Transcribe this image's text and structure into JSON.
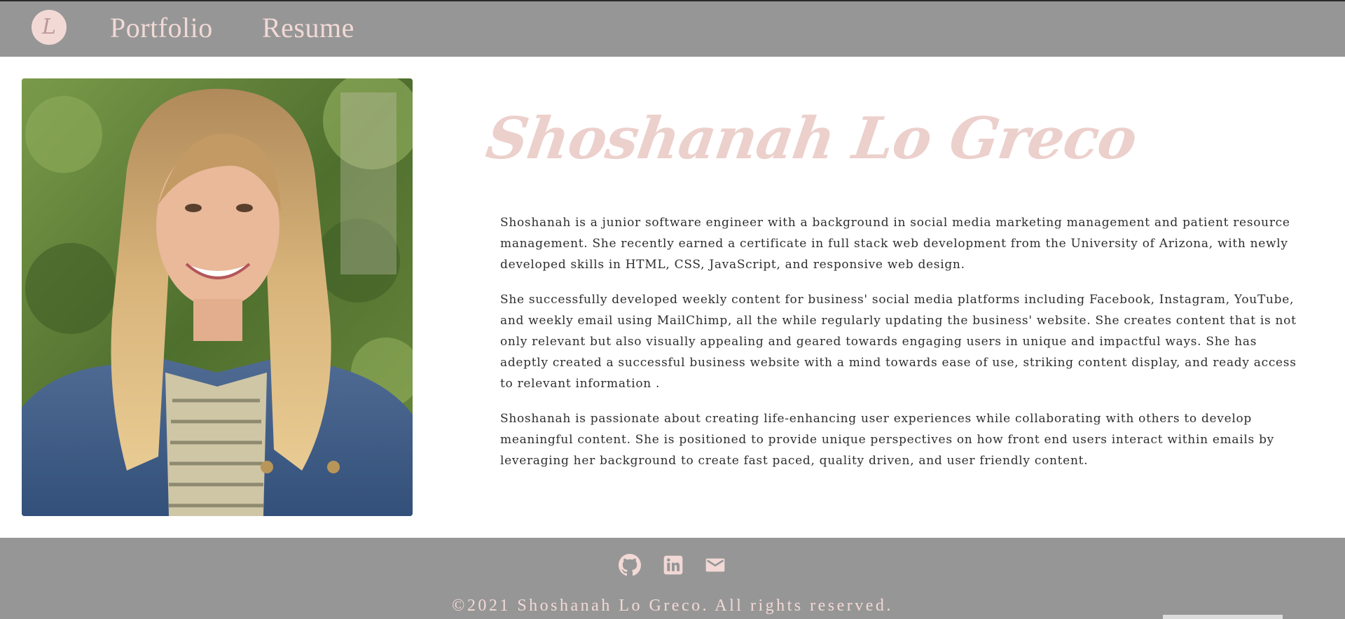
{
  "nav": {
    "logo_letter": "L",
    "links": [
      "Portfolio",
      "Resume"
    ]
  },
  "profile": {
    "photo_alt": "Portrait photo",
    "name": "Shoshanah Lo Greco"
  },
  "bio": {
    "paragraphs": [
      "Shoshanah is a junior software engineer with a background in social media marketing management and patient resource management. She recently earned a certificate in full stack web development from the University of Arizona, with newly developed skills in HTML, CSS, JavaScript, and responsive web design.",
      "She successfully developed weekly content for business' social media platforms including Facebook, Instagram, YouTube, and weekly email using MailChimp, all the while regularly updating the business' website. She creates content that is not only relevant but also visually appealing and geared towards engaging users in unique and impactful ways. She has adeptly created a successful business website with a mind towards ease of use, striking content display, and ready access to relevant information .",
      "Shoshanah is passionate about creating life-enhancing user experiences while collaborating with others to develop meaningful content. She is positioned to provide unique perspectives on how front end users interact within emails by leveraging her background to create fast paced, quality driven, and user friendly content."
    ]
  },
  "footer": {
    "icons": [
      "github-icon",
      "linkedin-icon",
      "email-icon"
    ],
    "copyright": "©2021 Shoshanah Lo Greco. All rights reserved."
  },
  "colors": {
    "nav_bg": "#969696",
    "accent_pink": "#f2d9d6",
    "name_pink": "#ecd0cc",
    "text": "#2e2e2e"
  }
}
